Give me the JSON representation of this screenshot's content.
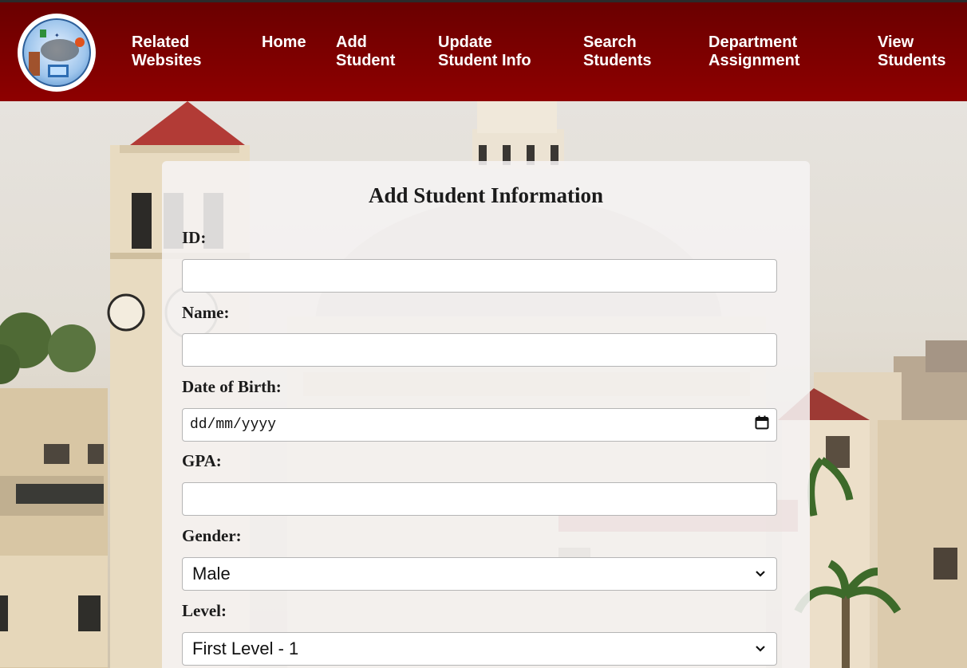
{
  "nav": {
    "related": "Related\nWebsites",
    "home": "Home",
    "add": "Add\nStudent",
    "update": "Update\nStudent Info",
    "search": "Search\nStudents",
    "department": "Department\nAssignment",
    "view": "View\nStudents"
  },
  "form": {
    "title": "Add Student Information",
    "id_label": "ID:",
    "id_value": "",
    "name_label": "Name:",
    "name_value": "",
    "dob_label": "Date of Birth:",
    "dob_value": "dd/mm/yyyy",
    "gpa_label": "GPA:",
    "gpa_value": "",
    "gender_label": "Gender:",
    "gender_value": "Male",
    "level_label": "Level:",
    "level_value": "First Level - 1"
  },
  "colors": {
    "header": "#7c0000",
    "card": "#f5f2f2"
  },
  "icons": {
    "logo": "university-logo-icon",
    "date": "calendar-icon",
    "dropdown": "chevron-down-icon"
  }
}
